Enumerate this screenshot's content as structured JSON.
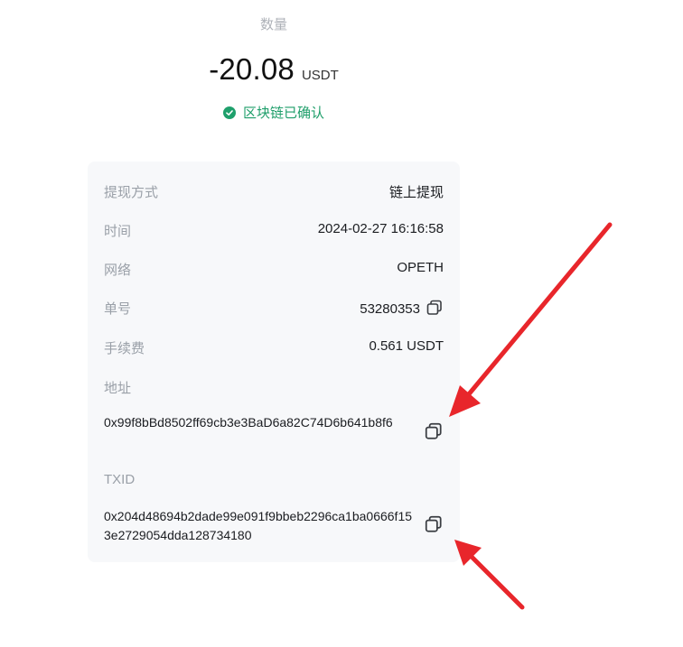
{
  "summary": {
    "amount_label": "数量",
    "amount_value": "-20.08",
    "amount_unit": "USDT",
    "status_text": "区块链已确认",
    "status_color": "#1fa06c"
  },
  "details": {
    "method_label": "提现方式",
    "method_value": "链上提现",
    "time_label": "时间",
    "time_value": "2024-02-27 16:16:58",
    "network_label": "网络",
    "network_value": "OPETH",
    "order_label": "单号",
    "order_value": "53280353",
    "fee_label": "手续费",
    "fee_value": "0.561 USDT",
    "address_label": "地址",
    "address_value": "0x99f8bBd8502ff69cb3e3BaD6a82C74D6b641b8f6",
    "txid_label": "TXID",
    "txid_value": "0x204d48694b2dade99e091f9bbeb2296ca1ba0666f153e2729054dda128734180"
  },
  "icons": {
    "status": "check-circle-icon",
    "copy": "copy-icon"
  },
  "annotation_color": "#e8262b"
}
